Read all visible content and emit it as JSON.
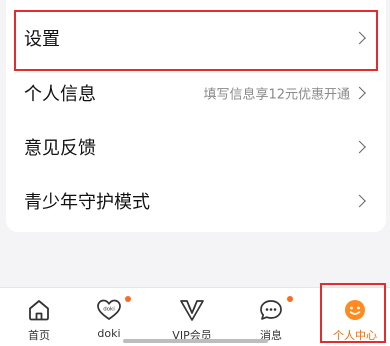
{
  "menu": {
    "items": [
      {
        "label": "设置",
        "hint": ""
      },
      {
        "label": "个人信息",
        "hint": "填写信息享12元优惠开通"
      },
      {
        "label": "意见反馈",
        "hint": ""
      },
      {
        "label": "青少年守护模式",
        "hint": ""
      }
    ]
  },
  "tabbar": {
    "tabs": [
      {
        "label": "首页",
        "icon": "home-icon",
        "badge": false,
        "active": false
      },
      {
        "label": "doki",
        "icon": "doki-heart-icon",
        "badge": true,
        "active": false
      },
      {
        "label": "VIP会员",
        "icon": "vip-crown-icon",
        "badge": false,
        "active": false
      },
      {
        "label": "消息",
        "icon": "message-bubble-icon",
        "badge": true,
        "active": false
      },
      {
        "label": "个人中心",
        "icon": "smiley-face-icon",
        "badge": false,
        "active": true
      }
    ]
  },
  "colors": {
    "accent": "#ff6a00",
    "badge": "#ff6a22",
    "highlight_box": "#e52b2b",
    "page_background": "#f4f4f6"
  }
}
